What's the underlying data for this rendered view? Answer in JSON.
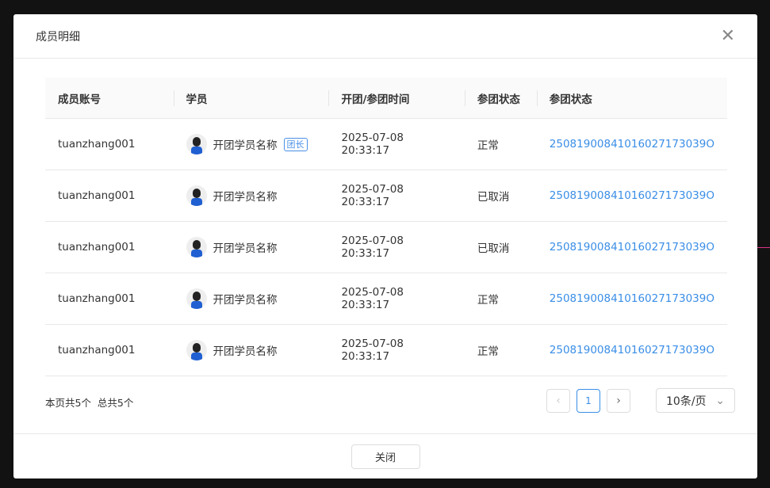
{
  "modal": {
    "title": "成员明细",
    "close_label": "关闭"
  },
  "table": {
    "headers": [
      "成员账号",
      "学员",
      "开团/参团时间",
      "参团状态",
      "参团状态"
    ],
    "rows": [
      {
        "account": "tuanzhang001",
        "student": "开团学员名称",
        "tag": "团长",
        "time": "2025-07-08 20:33:17",
        "status": "正常",
        "order": "25081900841016027173039O"
      },
      {
        "account": "tuanzhang001",
        "student": "开团学员名称",
        "time": "2025-07-08 20:33:17",
        "status": "已取消",
        "order": "25081900841016027173039O"
      },
      {
        "account": "tuanzhang001",
        "student": "开团学员名称",
        "time": "2025-07-08 20:33:17",
        "status": "已取消",
        "order": "25081900841016027173039O"
      },
      {
        "account": "tuanzhang001",
        "student": "开团学员名称",
        "time": "2025-07-08 20:33:17",
        "status": "正常",
        "order": "25081900841016027173039O"
      },
      {
        "account": "tuanzhang001",
        "student": "开团学员名称",
        "time": "2025-07-08 20:33:17",
        "status": "正常",
        "order": "25081900841016027173039O"
      }
    ]
  },
  "pagination": {
    "summary": "本页共5个  总共5个",
    "current": "1",
    "page_size": "10条/页"
  }
}
